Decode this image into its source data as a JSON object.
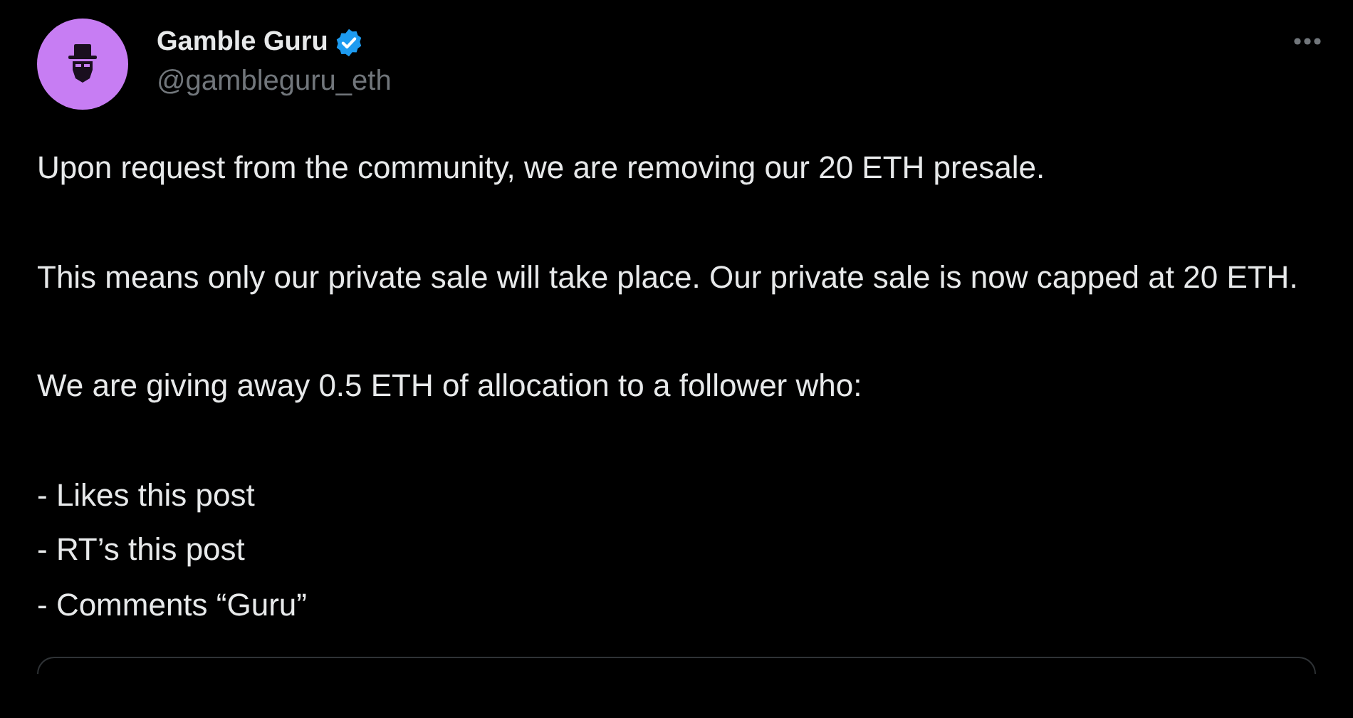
{
  "author": {
    "name": "Gamble Guru",
    "verified": true,
    "handle": "@gambleguru_eth"
  },
  "paragraphs": [
    {
      "lines": [
        "Upon request from the community, we are removing our 20 ETH presale."
      ]
    },
    {
      "lines": [
        "This means only our private sale will take place. Our private sale is now capped at 20 ETH."
      ]
    },
    {
      "lines": [
        "We are giving away 0.5 ETH of allocation to a follower who:"
      ]
    },
    {
      "lines": [
        "- Likes this post",
        "- RT’s this post",
        "- Comments “Guru”"
      ]
    }
  ]
}
